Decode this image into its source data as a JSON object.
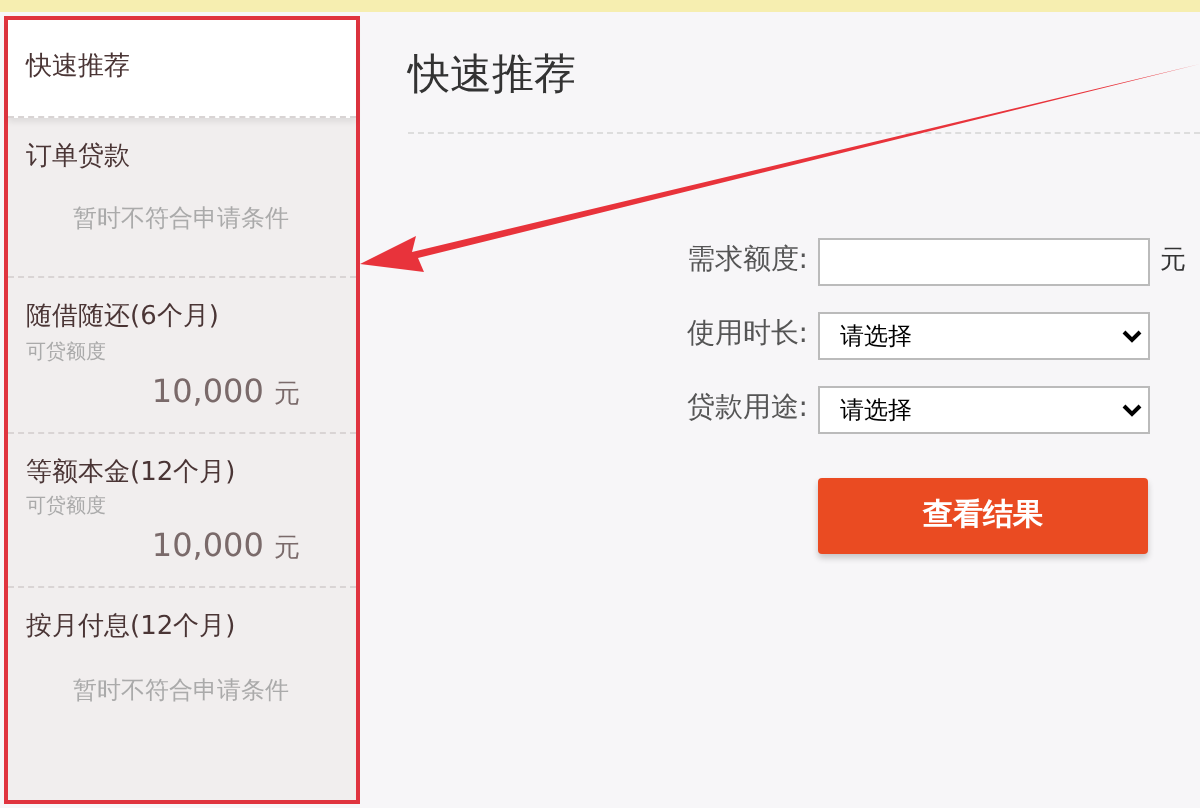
{
  "sidebar": {
    "items": [
      {
        "kind": "plain",
        "label": "快速推荐",
        "selected": true
      },
      {
        "kind": "note",
        "label": "订单贷款",
        "note": "暂时不符合申请条件",
        "selected": false
      },
      {
        "kind": "amount",
        "label": "随借随还(6个月)",
        "caption": "可贷额度",
        "amount": "10,000",
        "unit": "元",
        "selected": false
      },
      {
        "kind": "amount",
        "label": "等额本金(12个月)",
        "caption": "可贷额度",
        "amount": "10,000",
        "unit": "元",
        "selected": false
      },
      {
        "kind": "note",
        "label": "按月付息(12个月)",
        "note": "暂时不符合申请条件",
        "selected": false
      }
    ]
  },
  "main": {
    "title": "快速推荐",
    "form": {
      "fields": [
        {
          "kind": "text",
          "label": "需求额度:",
          "unit": "元"
        },
        {
          "kind": "select",
          "label": "使用时长:",
          "value": "请选择"
        },
        {
          "kind": "select",
          "label": "贷款用途:",
          "value": "请选择"
        }
      ],
      "submit": "查看结果"
    }
  }
}
